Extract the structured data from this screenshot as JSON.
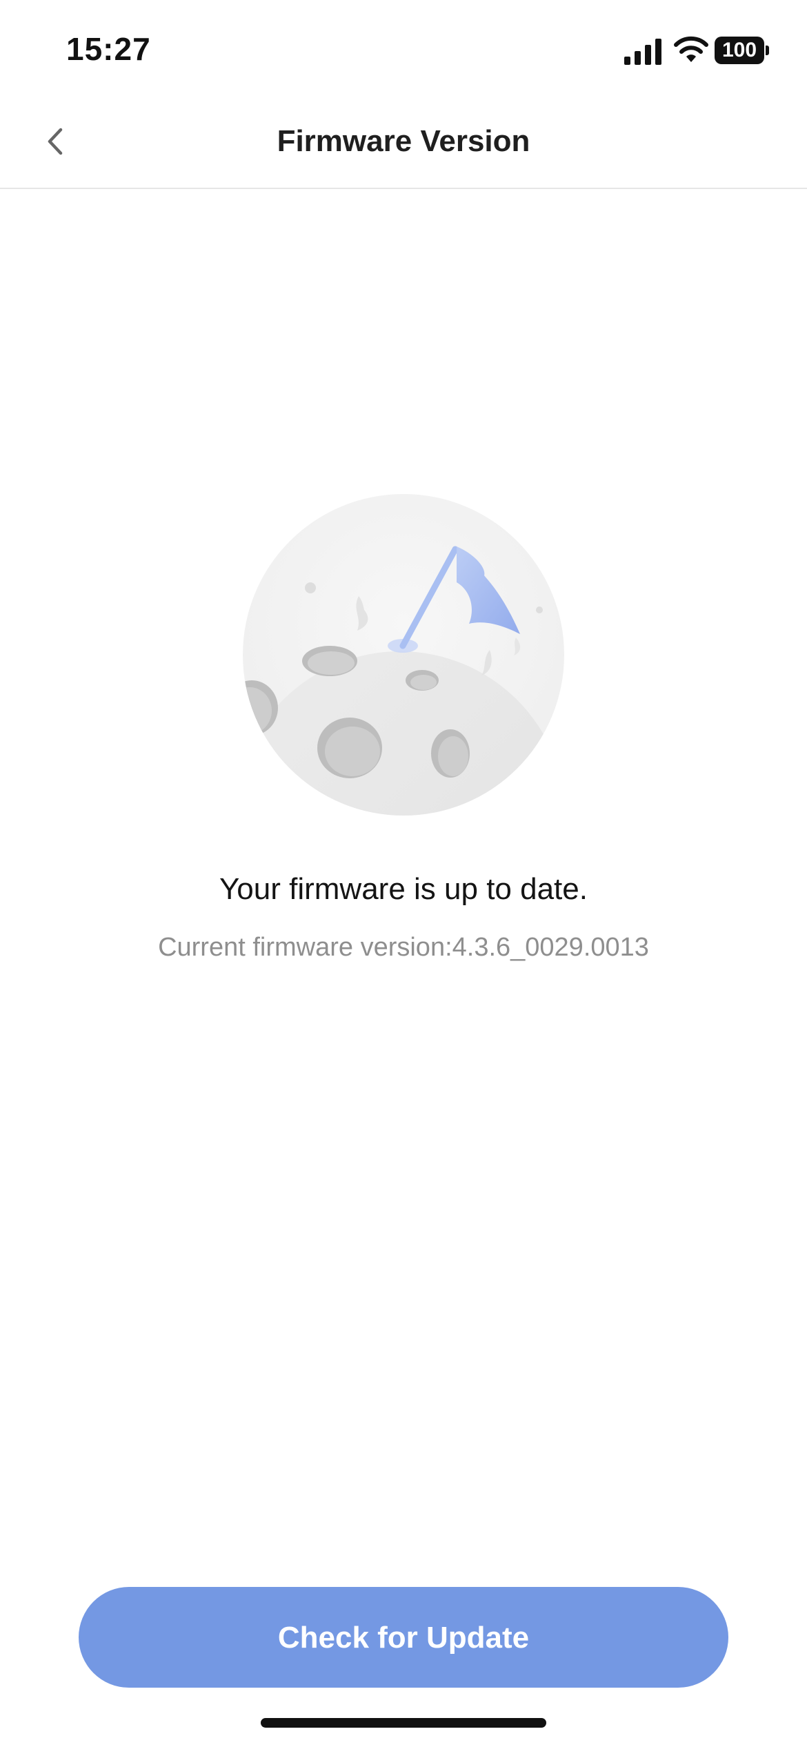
{
  "status_bar": {
    "time": "15:27",
    "battery_level": "100",
    "icons": [
      "signal-icon",
      "wifi-icon",
      "battery-icon"
    ]
  },
  "nav": {
    "title": "Firmware Version",
    "back_icon": "chevron-left-icon"
  },
  "illustration": {
    "name": "moon-flag-illustration",
    "accent_color": "#9FB6F0"
  },
  "content": {
    "status_message": "Your firmware is up to date.",
    "version_text": "Current firmware version:4.3.6_0029.0013"
  },
  "actions": {
    "check_button_label": "Check for Update",
    "button_color": "#7498E3"
  }
}
